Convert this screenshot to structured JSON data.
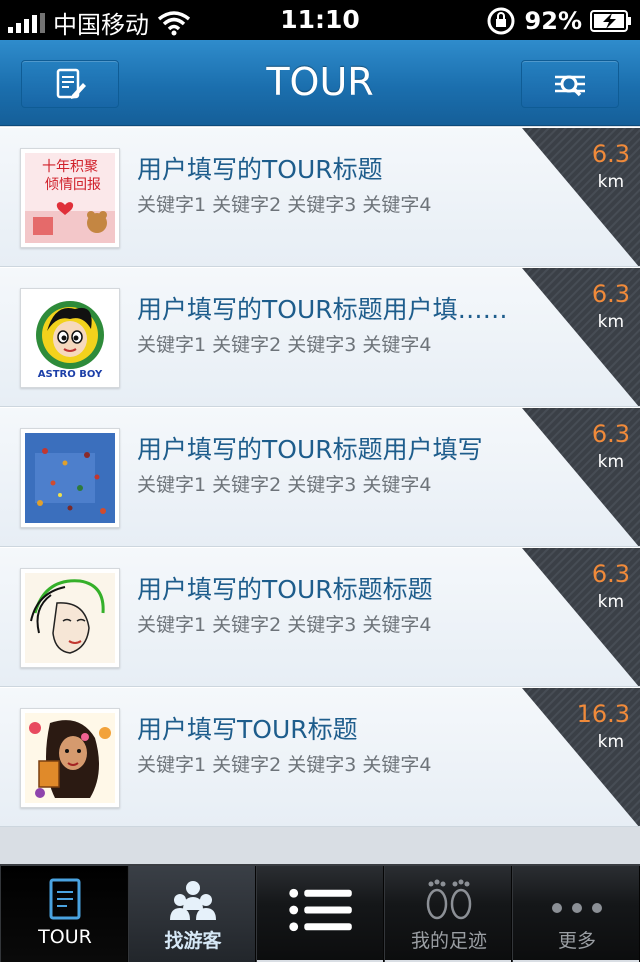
{
  "status_bar": {
    "carrier": "中国移动",
    "time": "11:10",
    "battery": "92%",
    "icons": [
      "signal-icon",
      "wifi-icon",
      "rotation-lock-icon",
      "battery-charging-icon"
    ]
  },
  "nav": {
    "title": "TOUR",
    "left_icon": "edit-note-icon",
    "right_icon": "search-filter-icon"
  },
  "items": [
    {
      "title": "用户填写的TOUR标题",
      "keywords": "关键字1 关键字2 关键字3 关键字4",
      "distance": "6.3",
      "unit": "km",
      "thumb": "promo-banner"
    },
    {
      "title": "用户填写的TOUR标题用户填……",
      "keywords": "关键字1 关键字2 关键字3 关键字4",
      "distance": "6.3",
      "unit": "km",
      "thumb": "astro-boy"
    },
    {
      "title": "用户填写的TOUR标题用户填写",
      "keywords": "关键字1 关键字2 关键字3 关键字4",
      "distance": "6.3",
      "unit": "km",
      "thumb": "blue-painting"
    },
    {
      "title": "用户填写的TOUR标题标题",
      "keywords": "关键字1 关键字2 关键字3 关键字4",
      "distance": "6.3",
      "unit": "km",
      "thumb": "lady-sketch"
    },
    {
      "title": "用户填写TOUR标题",
      "keywords": "关键字1 关键字2 关键字3 关键字4",
      "distance": "16.3",
      "unit": "km",
      "thumb": "girl-illustration"
    }
  ],
  "promo_thumb_text": {
    "line1": "十年积聚",
    "line2": "倾情回报"
  },
  "astro_thumb_text": "ASTRO BOY",
  "tabs": [
    {
      "label": "TOUR",
      "icon": "document-icon",
      "state": "active"
    },
    {
      "label": "找游客",
      "icon": "people-icon",
      "state": "highlight"
    },
    {
      "label": "",
      "icon": "list-icon",
      "state": "normal"
    },
    {
      "label": "我的足迹",
      "icon": "footprints-icon",
      "state": "normal"
    },
    {
      "label": "更多",
      "icon": "more-dots-icon",
      "state": "normal"
    }
  ],
  "colors": {
    "nav_blue": "#1b6fae",
    "title_blue": "#1e5d8c",
    "distance_orange": "#f08a3a",
    "corner_dark": "#3b4047"
  }
}
